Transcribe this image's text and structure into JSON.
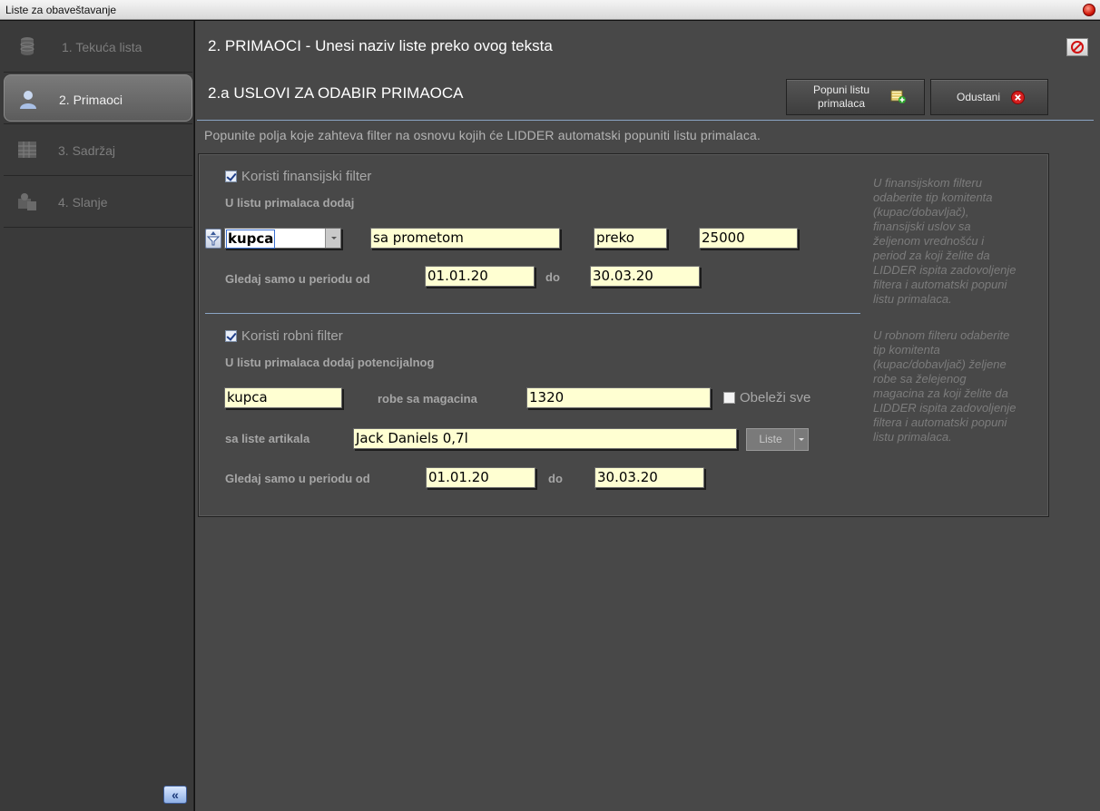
{
  "window": {
    "title": "Liste za obaveštavanje"
  },
  "sidebar": {
    "items": [
      {
        "label": "1. Tekuća lista",
        "icon": "database-icon",
        "active": false
      },
      {
        "label": "2. Primaoci",
        "icon": "user-icon",
        "active": true
      },
      {
        "label": "3. Sadržaj",
        "icon": "grid-icon",
        "active": false
      },
      {
        "label": "4. Slanje",
        "icon": "send-icon",
        "active": false
      }
    ],
    "collapse_label": "«"
  },
  "main": {
    "title": "2. PRIMAOCI - Unesi naziv liste preko ovog teksta",
    "subtitle": "2.a USLOVI ZA ODABIR PRIMAOCA",
    "toolbar": {
      "fill_line1": "Popuni listu",
      "fill_line2": "primalaca",
      "cancel": "Odustani"
    },
    "help": "Popunite polja koje zahteva filter na osnovu kojih će LIDDER automatski popuniti listu primalaca."
  },
  "financial": {
    "checkbox_label": "Koristi finansijski filter",
    "checked": true,
    "add_label": "U listu primalaca dodaj",
    "type_value": "kupca",
    "condition_value": "sa prometom",
    "operator_value": "preko",
    "amount_value": "25000",
    "period_label": "Gledaj samo u periodu od",
    "date_from": "01.01.20",
    "to_label": "do",
    "date_to": "30.03.20",
    "help_lines": [
      "U finansijskom filteru",
      "odaberite tip komitenta",
      "(kupac/dobavljač),",
      "finansijski uslov sa",
      "željenom vrednošću i",
      "period za koji želite da",
      "LIDDER ispita zadovoljenje",
      "filtera i automatski popuni",
      "listu primalaca."
    ]
  },
  "goods": {
    "checkbox_label": "Koristi robni filter",
    "checked": true,
    "add_label": "U listu primalaca dodaj potencijalnog",
    "type_value": "kupca",
    "warehouse_label": "robe sa magacina",
    "warehouse_value": "1320",
    "mark_all_label": "Obeleži sve",
    "mark_all_checked": false,
    "articles_label": "sa liste artikala",
    "articles_value": "Jack Daniels 0,7l",
    "lists_button": "Liste",
    "period_label": "Gledaj samo u periodu od",
    "date_from": "01.01.20",
    "to_label": "do",
    "date_to": "30.03.20",
    "help_lines": [
      "U robnom filteru odaberite",
      "tip komitenta",
      "(kupac/dobavljač) željene",
      "robe sa želejenog",
      "magacina za koji želite da",
      "LIDDER ispita zadovoljenje",
      "filtera i automatski popuni",
      "listu primalaca."
    ]
  },
  "colors": {
    "field_bg": "#ffffd2",
    "main_bg": "#484848",
    "sidebar_bg": "#3a3a3a",
    "accent_line": "#8aa4c4"
  }
}
